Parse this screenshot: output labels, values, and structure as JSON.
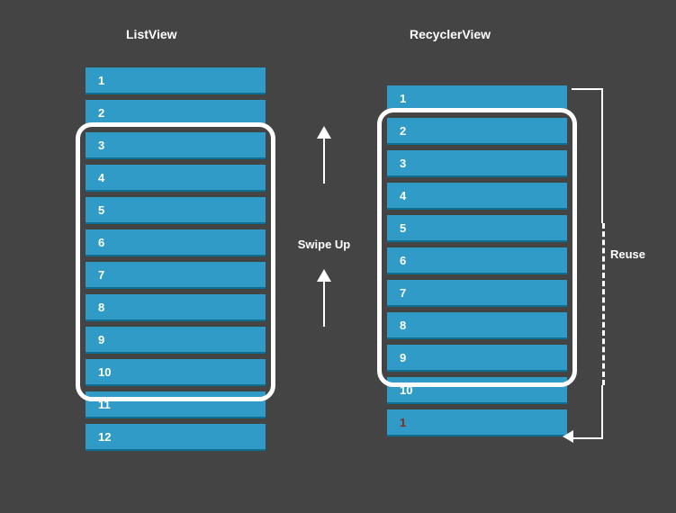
{
  "titles": {
    "left": "ListView",
    "right": "RecyclerView"
  },
  "swipe_label": "Swipe Up",
  "reuse_label": "Reuse",
  "listview_items": [
    "1",
    "2",
    "3",
    "4",
    "5",
    "6",
    "7",
    "8",
    "9",
    "10",
    "11",
    "12"
  ],
  "recyclerview_items": [
    "1",
    "2",
    "3",
    "4",
    "5",
    "6",
    "7",
    "8",
    "9",
    "10",
    "1"
  ],
  "colors": {
    "item_bg": "#2f9bc6",
    "background": "#444444",
    "frame": "#ffffff",
    "reused_text": "#8b2a1a"
  },
  "chart_data": {
    "type": "table",
    "title": "ListView vs RecyclerView item recycling",
    "series": [
      {
        "name": "ListView",
        "values": [
          1,
          2,
          3,
          4,
          5,
          6,
          7,
          8,
          9,
          10,
          11,
          12
        ]
      },
      {
        "name": "RecyclerView",
        "values": [
          1,
          2,
          3,
          4,
          5,
          6,
          7,
          8,
          9,
          10,
          1
        ]
      }
    ],
    "annotations": [
      "Swipe Up",
      "Reuse"
    ]
  }
}
